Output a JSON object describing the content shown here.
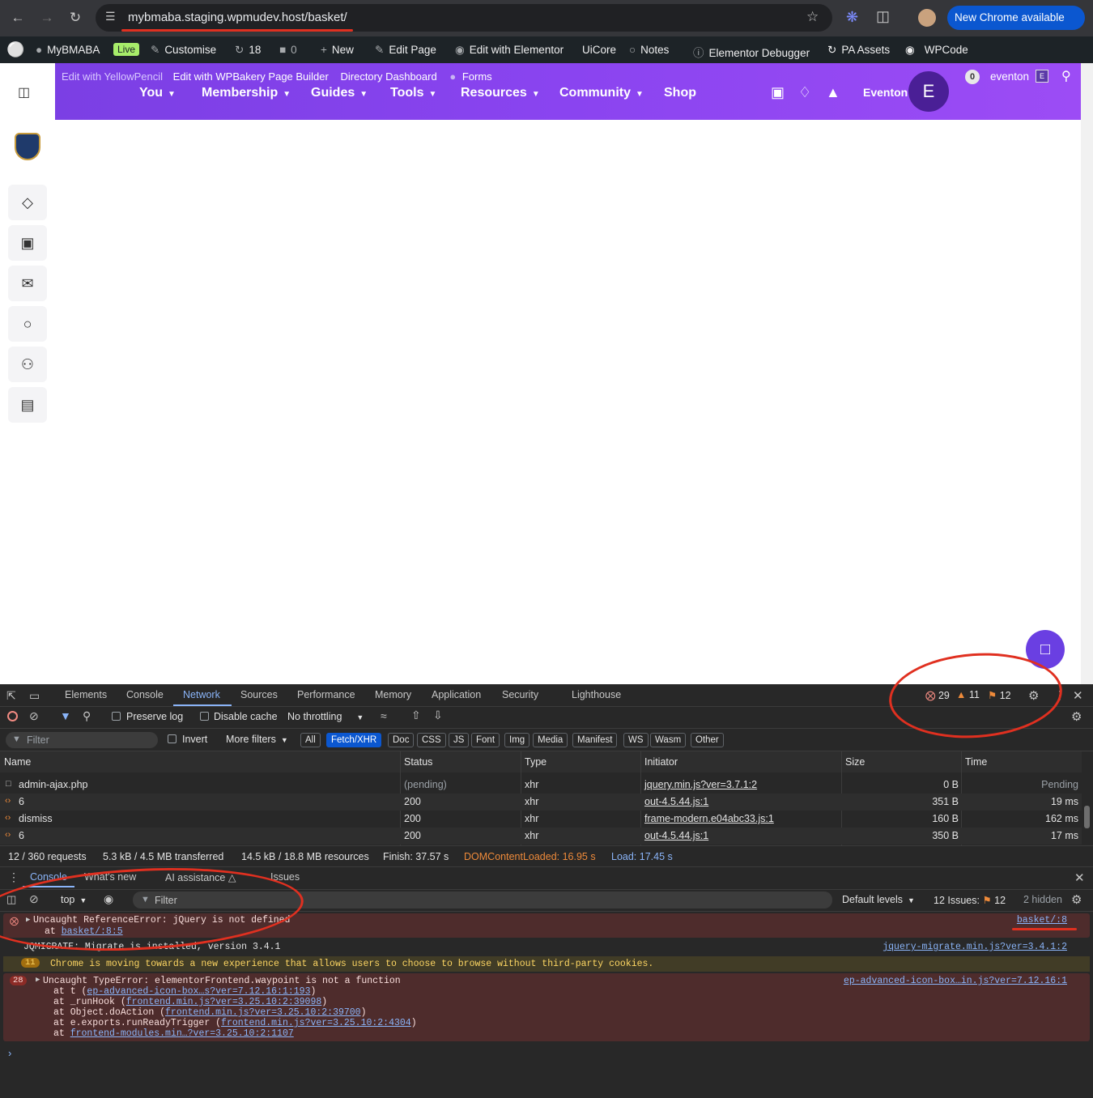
{
  "browser": {
    "url": "mybmaba.staging.wpmudev.host/basket/",
    "new_chrome_label": "New Chrome available"
  },
  "wp_bar": {
    "site_name": "MyBMABA",
    "live_badge": "Live",
    "customise": "Customise",
    "updates_count": "18",
    "comments_count": "0",
    "new": "New",
    "edit_page": "Edit Page",
    "edit_elementor": "Edit with Elementor",
    "uicore": "UiCore",
    "notes": "Notes",
    "elementor_debugger": "Elementor Debugger",
    "pa_assets": "PA Assets",
    "wpcode": "WPCode",
    "notif_count": "0",
    "user": "eventon",
    "user_badge": "E"
  },
  "site_header": {
    "sub_links": [
      "Edit with YellowPencil",
      "Edit with WPBakery Page Builder",
      "Directory Dashboard",
      "Forms"
    ],
    "menu": [
      "You",
      "Membership",
      "Guides",
      "Tools",
      "Resources",
      "Community",
      "Shop"
    ],
    "user_name": "Eventon",
    "avatar_letter": "E"
  },
  "devtools": {
    "tabs": [
      "Elements",
      "Console",
      "Network",
      "Sources",
      "Performance",
      "Memory",
      "Application",
      "Security",
      "Lighthouse"
    ],
    "active_tab": "Network",
    "error_count": "29",
    "warning_count": "11",
    "issue_count": "12",
    "preserve_log": "Preserve log",
    "disable_cache": "Disable cache",
    "throttling": "No throttling",
    "filter_placeholder": "Filter",
    "invert": "Invert",
    "more_filters": "More filters",
    "type_filters": [
      "All",
      "Fetch/XHR",
      "Doc",
      "CSS",
      "JS",
      "Font",
      "Img",
      "Media",
      "Manifest",
      "WS",
      "Wasm",
      "Other"
    ],
    "active_type_filter": "Fetch/XHR",
    "columns": [
      "Name",
      "Status",
      "Type",
      "Initiator",
      "Size",
      "Time"
    ],
    "rows": [
      {
        "name": "admin-ajax.php",
        "status": "(pending)",
        "type": "xhr",
        "initiator": "jquery.min.js?ver=3.7.1:2",
        "size": "0 B",
        "time": "Pending"
      },
      {
        "name": "6",
        "status": "200",
        "type": "xhr",
        "initiator": "out-4.5.44.js:1",
        "size": "351 B",
        "time": "19 ms"
      },
      {
        "name": "dismiss",
        "status": "200",
        "type": "xhr",
        "initiator": "frame-modern.e04abc33.js:1",
        "size": "160 B",
        "time": "162 ms"
      },
      {
        "name": "6",
        "status": "200",
        "type": "xhr",
        "initiator": "out-4.5.44.js:1",
        "size": "350 B",
        "time": "17 ms"
      }
    ],
    "summary": {
      "requests": "12 / 360 requests",
      "transferred": "5.3 kB / 4.5 MB transferred",
      "resources": "14.5 kB / 18.8 MB resources",
      "finish": "Finish: 37.57 s",
      "dcl": "DOMContentLoaded: 16.95 s",
      "load": "Load: 17.45 s"
    },
    "drawer_tabs": [
      "Console",
      "What's new",
      "AI assistance",
      "Issues"
    ],
    "context": "top",
    "console_filter": "Filter",
    "default_levels": "Default levels",
    "issues_label": "12 Issues:",
    "issues_count": "12",
    "hidden": "2 hidden",
    "messages": {
      "m1_text": "Uncaught ReferenceError: jQuery is not defined",
      "m1_at": "at ",
      "m1_link": "basket/:8:5",
      "m1_source": "basket/:8",
      "m2_text": "JQMIGRATE: Migrate is installed, version 3.4.1",
      "m2_source": "jquery-migrate.min.js?ver=3.4.1:2",
      "m3_count": "11",
      "m3_text": "Chrome is moving towards a new experience that allows users to choose to browse without third-party cookies.",
      "m4_count": "28",
      "m4_text": "Uncaught TypeError: elementorFrontend.waypoint is not a function",
      "m4_source": "ep-advanced-icon-box…in.js?ver=7.12.16:1",
      "m4_stack": [
        {
          "pre": "at t (",
          "link": "ep-advanced-icon-box…s?ver=7.12.16:1:193",
          "post": ")"
        },
        {
          "pre": "at _runHook (",
          "link": "frontend.min.js?ver=3.25.10:2:39098",
          "post": ")"
        },
        {
          "pre": "at Object.doAction (",
          "link": "frontend.min.js?ver=3.25.10:2:39700",
          "post": ")"
        },
        {
          "pre": "at e.exports.runReadyTrigger (",
          "link": "frontend.min.js?ver=3.25.10:2:4304",
          "post": ")"
        },
        {
          "pre": "at ",
          "link": "frontend-modules.min…?ver=3.25.10:2:1107",
          "post": ""
        }
      ]
    }
  }
}
